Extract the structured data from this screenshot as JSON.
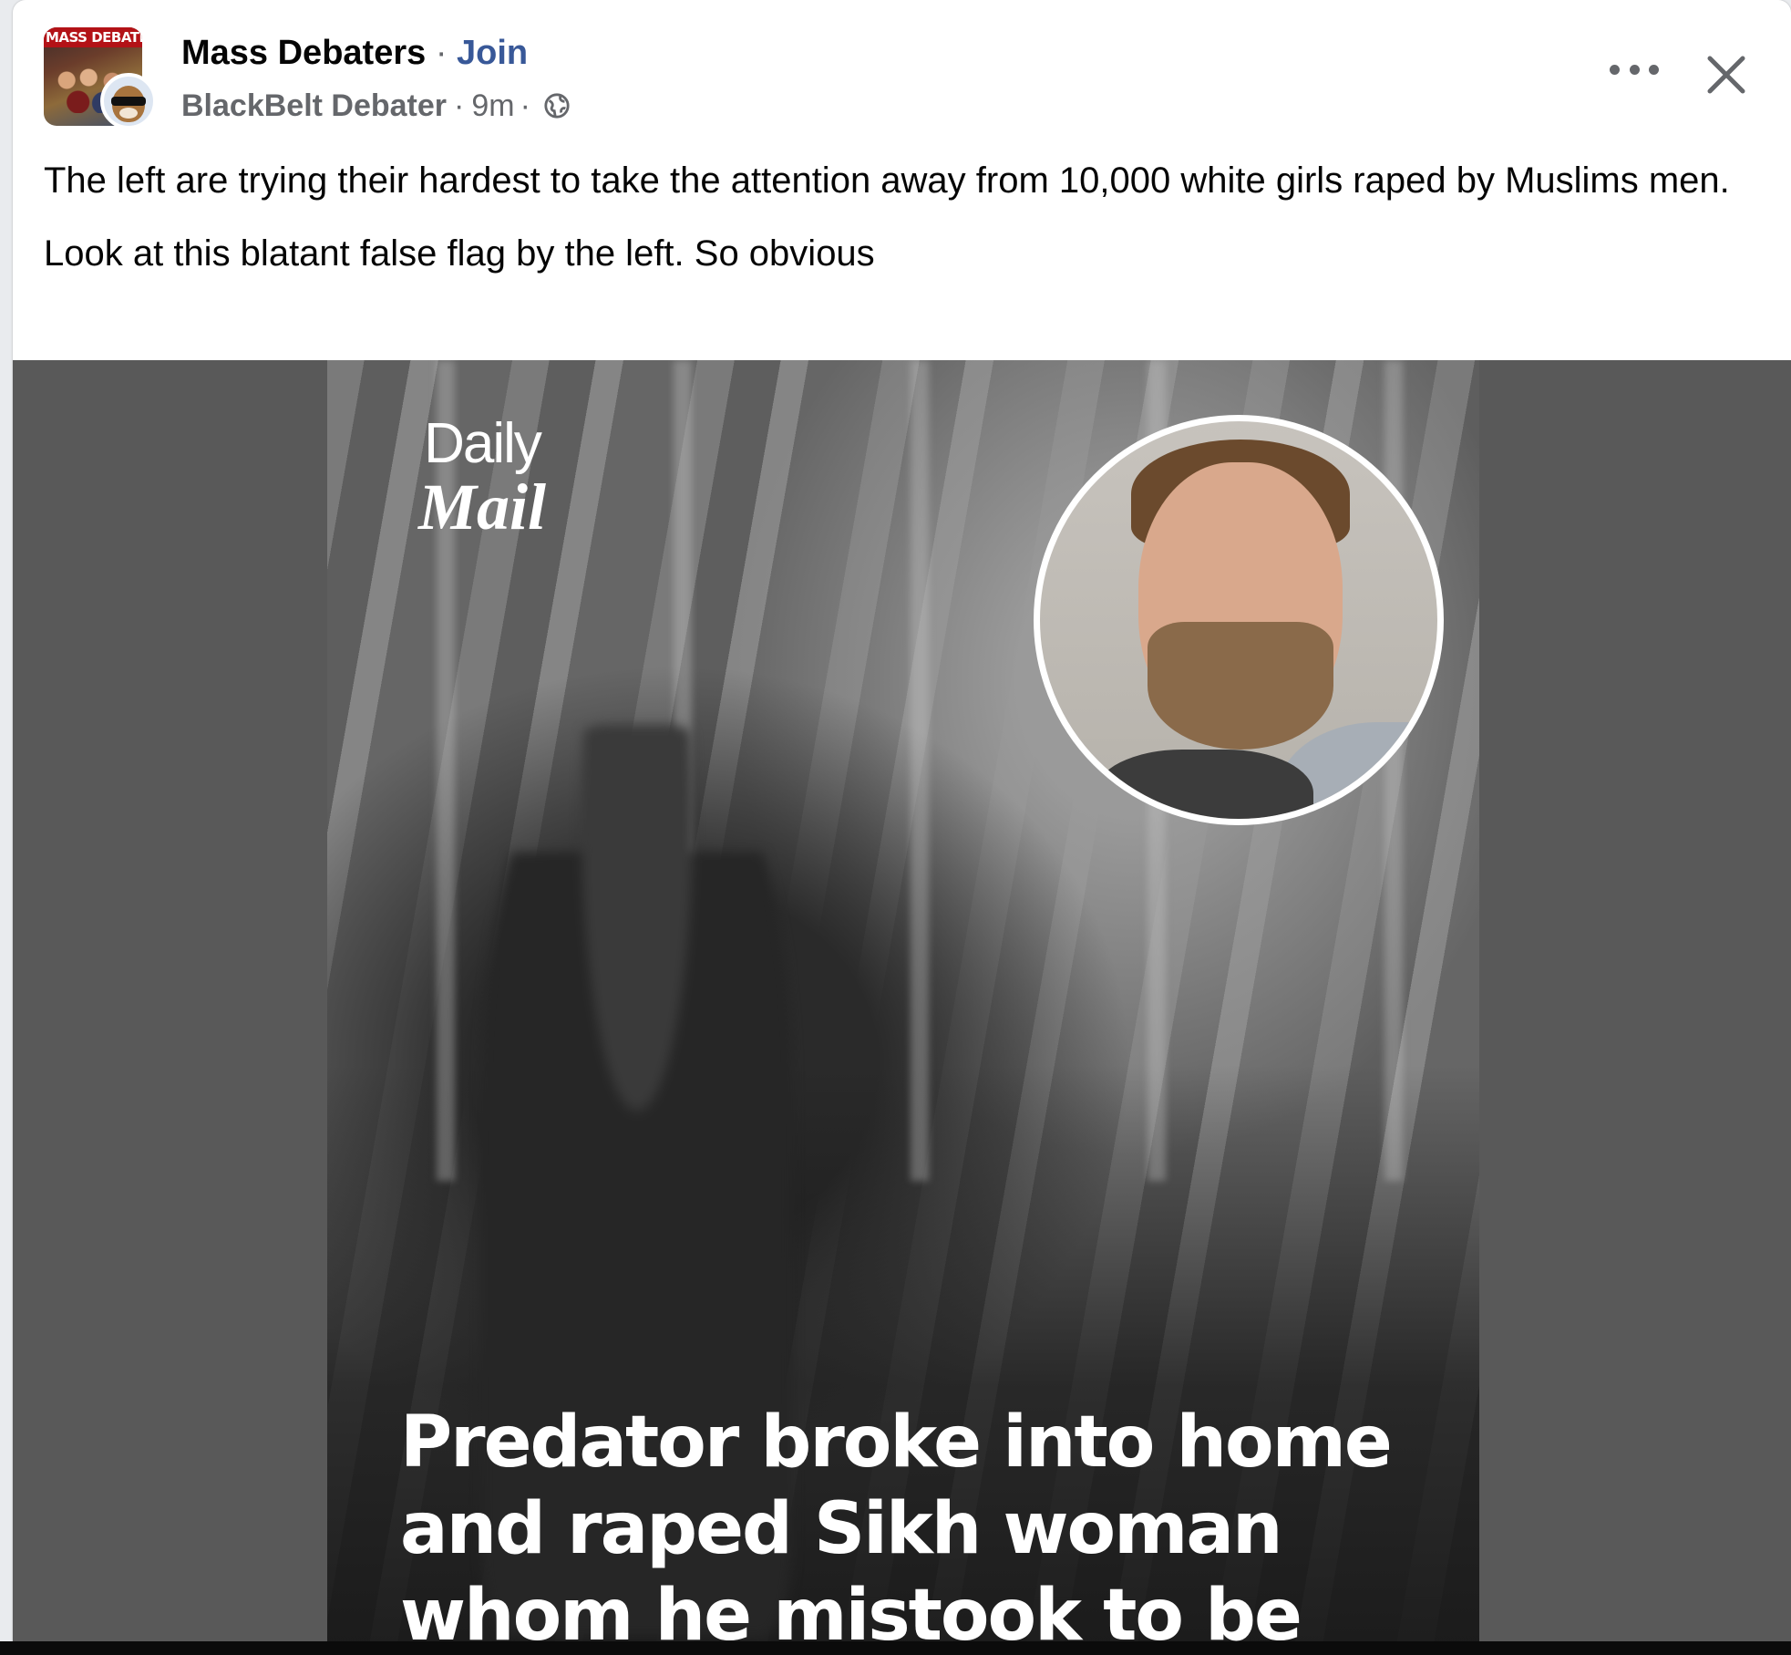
{
  "header": {
    "group_name": "Mass Debaters",
    "separator": "·",
    "join_label": "Join",
    "author_name": "BlackBelt Debater",
    "time_ago": "9m",
    "audience_icon": "globe-icon",
    "group_avatar_banner": "MASS DEBATERS",
    "more_icon": "more-horizontal-icon",
    "close_icon": "close-icon"
  },
  "post": {
    "paragraphs": [
      "The left are trying their hardest to take the attention away from 10,000 white girls raped by Muslims men.",
      "Look at this blatant false flag by the left. So obvious"
    ]
  },
  "media": {
    "brand_line1": "Daily",
    "brand_line2": "Mail",
    "headline_lines": [
      "Predator broke into home",
      "and raped Sikh woman",
      "whom he mistook to be"
    ]
  },
  "colors": {
    "link": "#385898",
    "secondary_text": "#65676b",
    "primary_text": "#050505",
    "media_background": "#595959"
  }
}
